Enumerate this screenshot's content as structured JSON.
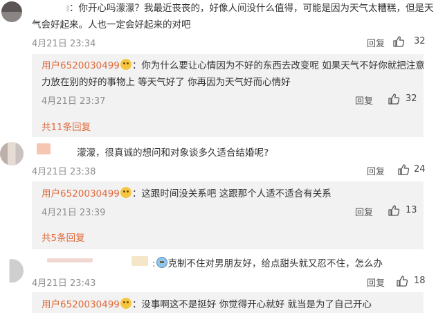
{
  "comments": [
    {
      "text_line1": "：你开心吗濛濛？我最近丧丧的，好像人间没什么值得，可能是因为天气太糟糕，但是天",
      "text_line2": "气会好起来。人也一定会好起来的对吧",
      "time": "4月21日 23:34",
      "reply_label": "回复",
      "likes": "32",
      "reply": {
        "user": "用户6520030499",
        "text_line1": "：你为什么要让心情因为不好的东西去改变呢 如果天气不好你就把注意",
        "text_line2": "力放在别的好的事物上 等天气好了 你再因为天气好而心情好",
        "time": "4月21日 23:37",
        "reply_label": "回复",
        "likes": "32"
      },
      "more_replies": "共11条回复"
    },
    {
      "text_line1": "濛濛，很真诚的想问和对象谈多久适合结婚呢?",
      "time": "4月21日 23:38",
      "reply_label": "回复",
      "likes": "24",
      "reply": {
        "user": "用户6520030499",
        "text_line1": "：这跟时间没关系吧 这跟那个人适不适合有关系",
        "time": "4月21日 23:39",
        "reply_label": "回复",
        "likes": "13"
      },
      "more_replies": "共5条回复"
    },
    {
      "text_line1": "克制不住对男朋友好，给点甜头就又忍不住，怎么办",
      "time": "4月21日 23:43",
      "reply_label": "回复",
      "likes": "18",
      "reply": {
        "user": "用户6520030499",
        "text_line1": "：没事啊这不是挺好 你觉得开心就好 就当是为了自己开心"
      }
    }
  ],
  "icons": {
    "like": "thumbs-up-icon",
    "verified": "emoji-icon"
  },
  "colors": {
    "username": "#e06a3c",
    "reply_bg": "#f2f2f2",
    "meta": "#8e8e8e"
  }
}
